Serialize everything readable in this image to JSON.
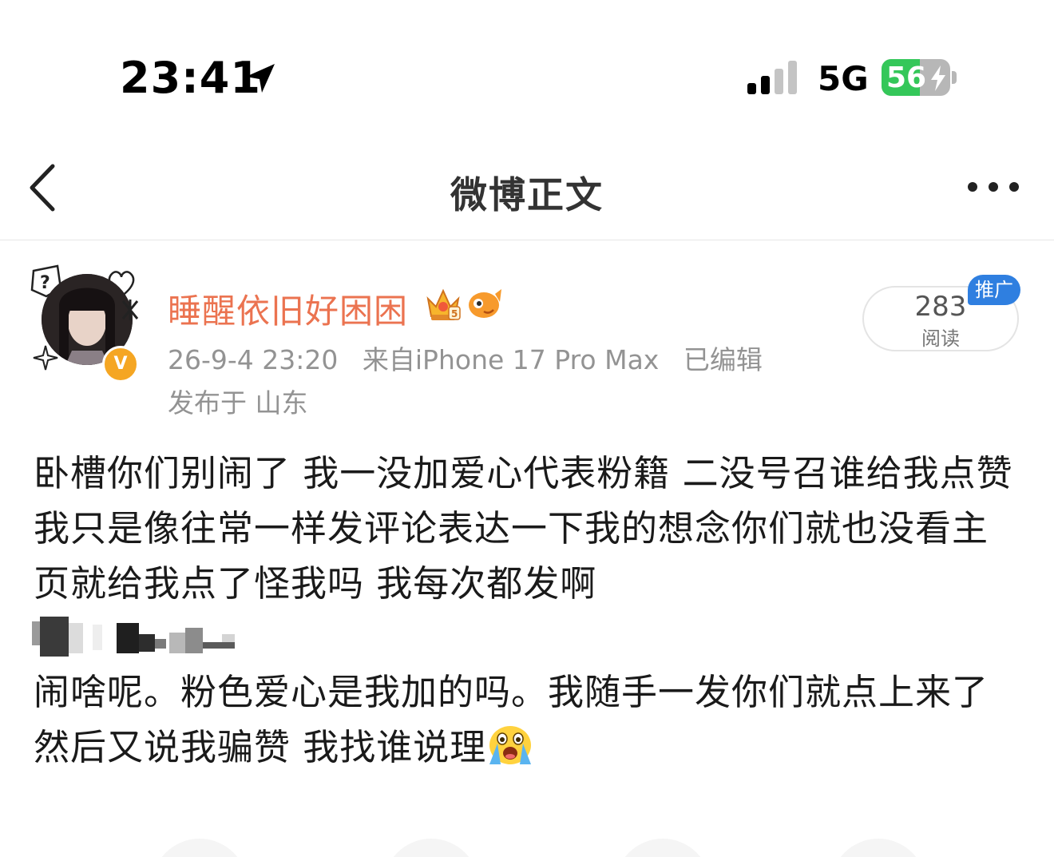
{
  "status_bar": {
    "time": "23:41",
    "network": "5G",
    "battery_level": "56",
    "battery_fraction": 0.56,
    "icons": [
      "location-arrow-icon",
      "cellular-signal-icon",
      "battery-charging-icon"
    ]
  },
  "nav": {
    "title": "微博正文",
    "icons": [
      "back-chevron-icon",
      "more-dots-icon"
    ]
  },
  "author": {
    "name": "睡醒依旧好困困",
    "verified_badge": "V",
    "icons": [
      "crown-badge-icon",
      "pet-badge-icon"
    ]
  },
  "post_meta": {
    "date_time": "26-9-4 23:20",
    "source": "来自iPhone 17 Pro Max",
    "edited": "已编辑",
    "location": "发布于 山东"
  },
  "stats": {
    "read_count": "283",
    "read_label": "阅读",
    "promo_tag": "推广"
  },
  "content": {
    "paragraph_1": "卧槽你们别闹了 我一没加爱心代表粉籍 二没号召谁给我点赞 我只是像往常一样发评论表达一下我的想念你们就也没看主页就给我点了怪我吗 我每次都发啊",
    "paragraph_2": "闹啥呢。粉色爱心是我加的吗。我随手一发你们就点上来了 然后又说我骗赞 我找谁说理"
  },
  "colors": {
    "username": "#eb7350",
    "meta": "#939393",
    "battery_green": "#34c759",
    "verified_orange": "#f5a623",
    "promo_blue": "#2f7fe0"
  }
}
